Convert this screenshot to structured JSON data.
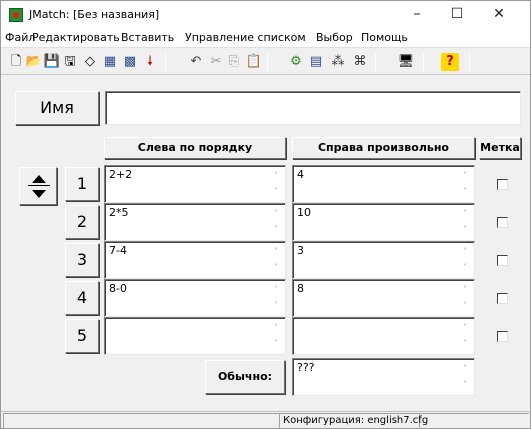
{
  "window": {
    "title": "JMatch: [Без названия]",
    "controls": {
      "minimize": "–",
      "maximize": "☐",
      "close": "✕"
    }
  },
  "menu": {
    "items": [
      "Файл",
      "Редактировать",
      "Вставить",
      "Управление списком",
      "Выбор",
      "Помощь"
    ]
  },
  "toolbar": {
    "icons": [
      {
        "name": "new-icon",
        "glyph": "🗋"
      },
      {
        "name": "open-icon",
        "glyph": "📂"
      },
      {
        "name": "save-icon",
        "glyph": "💾"
      },
      {
        "name": "save-as-icon",
        "glyph": "🖫"
      },
      {
        "name": "eraser-icon",
        "glyph": "◇"
      },
      {
        "name": "web-export-icon",
        "glyph": "▦"
      },
      {
        "name": "web-export-2-icon",
        "glyph": "▩"
      },
      {
        "name": "insert-arrow-icon",
        "glyph": "🠗"
      },
      {
        "name": "undo-icon",
        "glyph": "↶"
      },
      {
        "name": "cut-icon",
        "glyph": "✂"
      },
      {
        "name": "copy-icon",
        "glyph": "⎘"
      },
      {
        "name": "paste-icon",
        "glyph": "📋"
      },
      {
        "name": "config-icon",
        "glyph": "⚙"
      },
      {
        "name": "list-icon",
        "glyph": "▤"
      },
      {
        "name": "tree-icon",
        "glyph": "⁂"
      },
      {
        "name": "structure-icon",
        "glyph": "⌘"
      },
      {
        "name": "monitor-icon",
        "glyph": "🖥"
      },
      {
        "name": "help-icon",
        "glyph": "?"
      }
    ]
  },
  "form": {
    "name_label": "Имя",
    "name_value": "",
    "columns": {
      "left": "Слева по порядку",
      "right": "Справа произвольно",
      "mark": "Метка"
    },
    "rows": [
      {
        "number": "1",
        "left": "2+2",
        "right": "4",
        "checked": false
      },
      {
        "number": "2",
        "left": "2*5",
        "right": "10",
        "checked": false
      },
      {
        "number": "3",
        "left": "7-4",
        "right": "3",
        "checked": false
      },
      {
        "number": "4",
        "left": "8-0",
        "right": "8",
        "checked": false
      },
      {
        "number": "5",
        "left": "",
        "right": "",
        "checked": false
      }
    ],
    "default_label": "Обычно:",
    "default_value": "???"
  },
  "status": {
    "config": "Конфигурация: english7.cfg"
  }
}
